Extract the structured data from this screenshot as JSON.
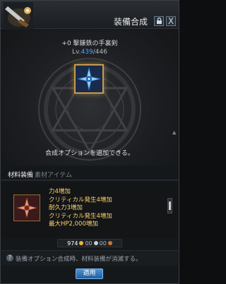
{
  "window": {
    "title": "装備合成",
    "lock_icon": "lock-icon",
    "close_label": "X"
  },
  "item": {
    "name": "+0 擊鎌鉄の手裏剣",
    "level_prefix": "Lv.",
    "level_current": "439",
    "level_sep_max": "/446"
  },
  "stage": {
    "hint": "合成オプションを追加できる。"
  },
  "tabs": {
    "active": "材料装備",
    "separator": "|",
    "inactive": "素材アイテム"
  },
  "material": {
    "options": [
      "力4増加",
      "クリティカル発生4増加",
      "耐久力3増加",
      "クリティカル発生4増加",
      "最大HP2,000増加"
    ]
  },
  "cost": {
    "gold": "974",
    "silver": "00",
    "copper": "00"
  },
  "notice": {
    "icon": "question-icon",
    "text": "装備オプション合成時、材料装備が消滅する。"
  },
  "apply_button": "適用",
  "colors": {
    "accent_blue": "#4da6ff",
    "option_gold": "#ffd36a",
    "button_blue": "#3a7fc4"
  }
}
